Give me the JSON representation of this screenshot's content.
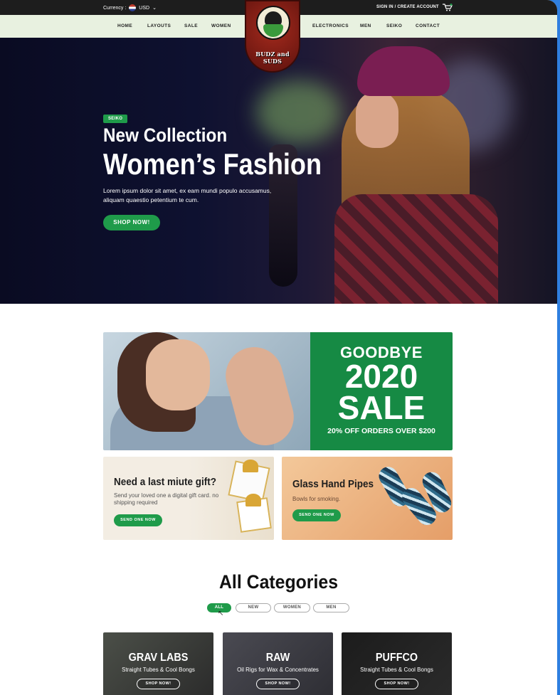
{
  "topbar": {
    "currency_label": "Currency :",
    "currency_value": "USD",
    "sign_in": "SIGN IN / CREATE ACCOUNT"
  },
  "nav": {
    "left": [
      "HOME",
      "LAYOUTS",
      "SALE",
      "WOMEN"
    ],
    "right": [
      "ELECTRONICS",
      "MEN",
      "SEIKO",
      "CONTACT"
    ]
  },
  "logo": {
    "text": "BUDZ and SUDS"
  },
  "hero": {
    "tag": "SEIKO",
    "subtitle": "New Collection",
    "title": "Women’s Fashion",
    "description": "Lorem ipsum dolor sit amet, ex eam mundi populo accusamus, aliquam quaestio petentium te cum.",
    "button": "SHOP NOW!"
  },
  "sale_banner": {
    "line1": "GOODBYE",
    "line2": "2020",
    "line3": "SALE",
    "line4": "20% OFF ORDERS OVER $200"
  },
  "promos": [
    {
      "title": "Need a last miute gift?",
      "description": "Send your loved one a digital gift card. no shipping required",
      "button": "SEND ONE NOW"
    },
    {
      "title": "Glass Hand Pipes",
      "description": "Bowls for smoking.",
      "button": "SEND ONE NOW"
    }
  ],
  "categories": {
    "title": "All Categories",
    "filters": [
      "ALL",
      "NEW",
      "WOMEN",
      "MEN"
    ],
    "active_filter": "ALL",
    "items": [
      {
        "name": "GRAV LABS",
        "description": "Straight Tubes & Cool Bongs",
        "button": "SHOP NOW!"
      },
      {
        "name": "RAW",
        "description": "Oil Rigs for Wax & Concentrates",
        "button": "SHOP NOW!"
      },
      {
        "name": "PUFFCO",
        "description": "Straight Tubes & Cool Bongs",
        "button": "SHOP NOW!"
      }
    ]
  },
  "colors": {
    "accent": "#1f9b4a",
    "nav_bg": "#e8f1e0",
    "topbar_bg": "#1d1d1d",
    "sale_bg": "#168a44"
  },
  "icons": [
    "flag-us-icon",
    "chevron-down-icon",
    "cart-icon",
    "cursor-icon"
  ]
}
